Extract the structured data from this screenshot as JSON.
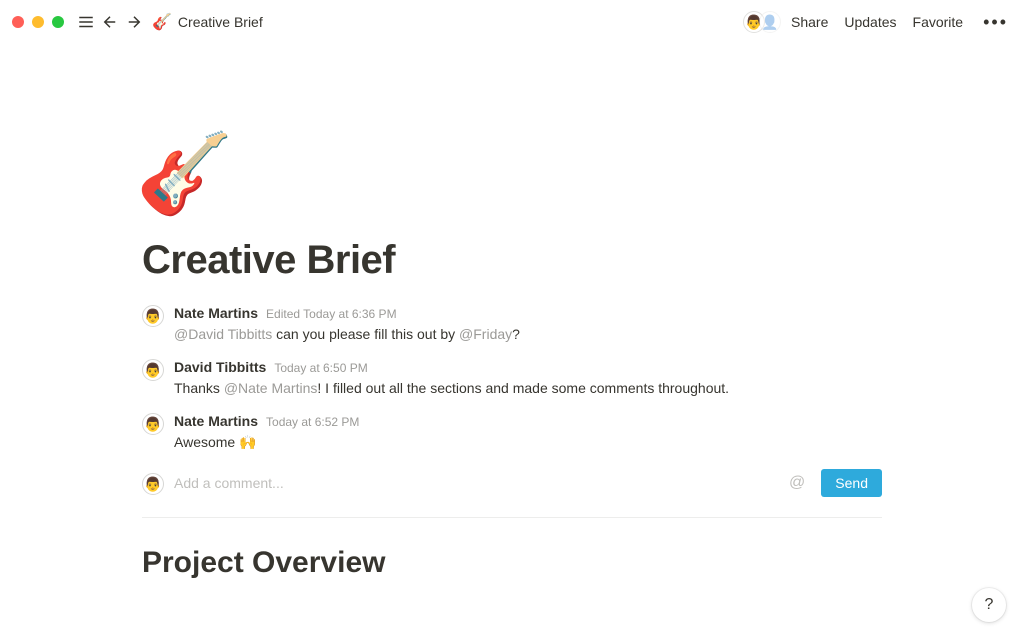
{
  "breadcrumb": {
    "icon": "🎸",
    "title": "Creative Brief"
  },
  "top_actions": {
    "share": "Share",
    "updates": "Updates",
    "favorite": "Favorite"
  },
  "page": {
    "icon": "🎸",
    "title": "Creative Brief",
    "section_heading": "Project Overview"
  },
  "comments": [
    {
      "author": "Nate Martins",
      "timestamp": "Edited Today at 6:36 PM",
      "segments": [
        {
          "type": "mention",
          "text": "@David Tibbitts"
        },
        {
          "type": "text",
          "text": " can you please fill this out by "
        },
        {
          "type": "mention",
          "text": "@Friday"
        },
        {
          "type": "text",
          "text": "?"
        }
      ]
    },
    {
      "author": "David Tibbitts",
      "timestamp": "Today at 6:50 PM",
      "segments": [
        {
          "type": "text",
          "text": "Thanks "
        },
        {
          "type": "mention",
          "text": "@Nate Martins"
        },
        {
          "type": "text",
          "text": "! I filled out all the sections and made some comments throughout."
        }
      ]
    },
    {
      "author": "Nate Martins",
      "timestamp": "Today at 6:52 PM",
      "segments": [
        {
          "type": "text",
          "text": "Awesome 🙌"
        }
      ]
    }
  ],
  "composer": {
    "placeholder": "Add a comment...",
    "send": "Send",
    "at": "@"
  },
  "help": "?"
}
